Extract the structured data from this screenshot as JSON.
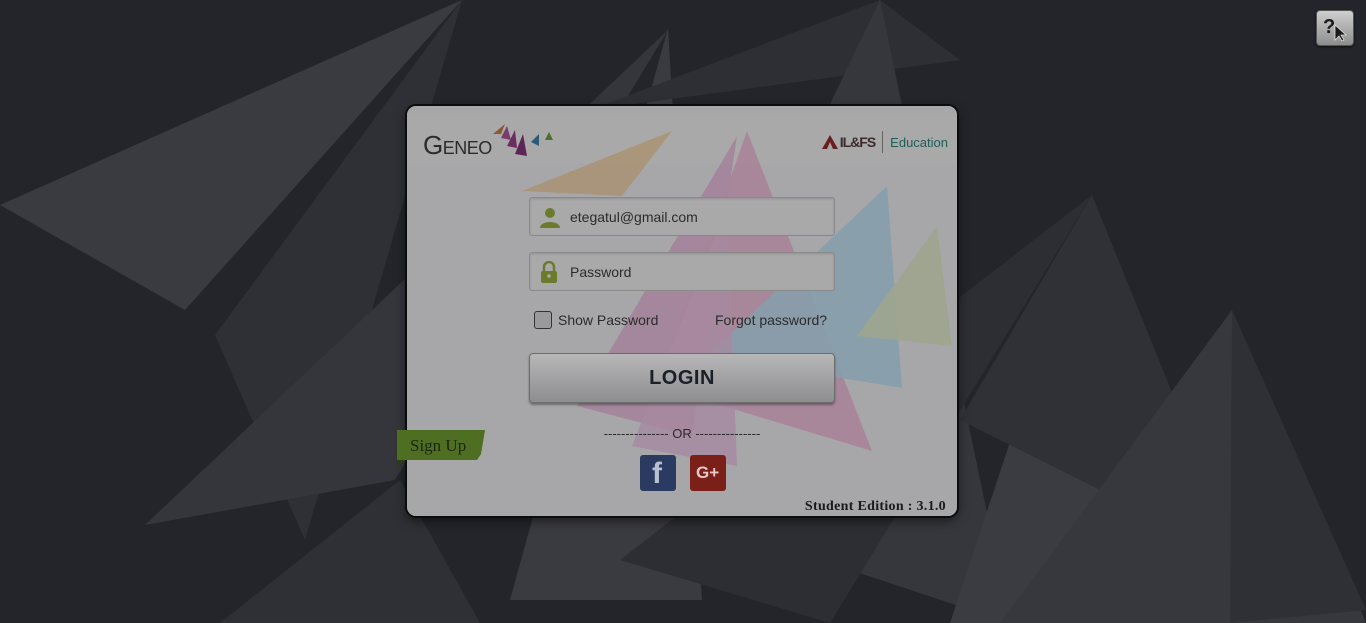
{
  "help": {
    "icon": "help-cursor-icon"
  },
  "brand": {
    "logo_text": "Geneo",
    "partner_name": "IL&FS",
    "partner_division": "Education"
  },
  "login": {
    "email_value": "etegatul@gmail.com",
    "password_placeholder": "Password",
    "show_password_label": "Show Password",
    "show_password_checked": false,
    "forgot_label": "Forgot password?",
    "login_label": "LOGIN",
    "or_separator": "--------------- OR ---------------"
  },
  "social": {
    "facebook_glyph": "f",
    "google_glyph": "G+"
  },
  "signup_label": "Sign Up",
  "edition_label": "Student Edition : 3.1.0",
  "colors": {
    "page_bg": "#23252b",
    "card_bg": "#a6a6a8",
    "signup_green": "#4e6e22",
    "icon_green": "#6b7a2c",
    "facebook": "#2b3a60",
    "google": "#7b1f19"
  }
}
